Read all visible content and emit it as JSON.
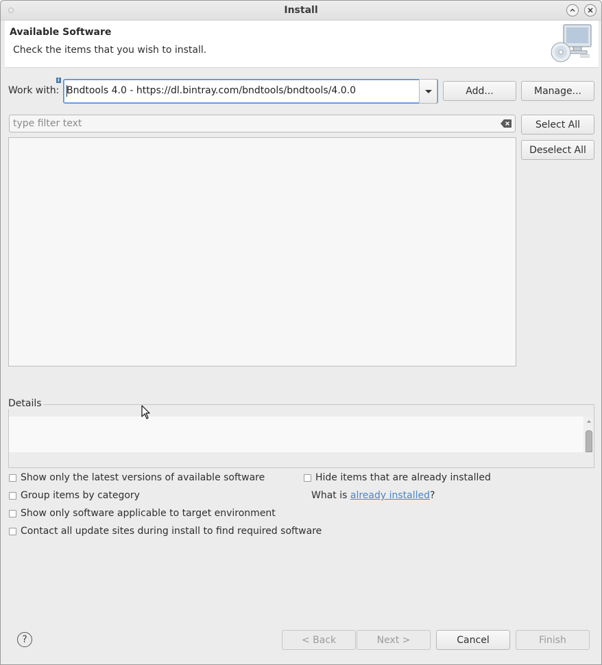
{
  "window": {
    "title": "Install"
  },
  "banner": {
    "heading": "Available Software",
    "subtitle": "Check the items that you wish to install."
  },
  "work_with": {
    "label": "Work with:",
    "value": "Bndtools 4.0 - https://dl.bintray.com/bndtools/bndtools/4.0.0",
    "add_label": "Add...",
    "manage_label": "Manage..."
  },
  "filter": {
    "placeholder": "type filter text",
    "select_all_label": "Select All",
    "deselect_all_label": "Deselect All"
  },
  "details": {
    "label": "Details"
  },
  "options": {
    "latest_versions": "Show only the latest versions of available software",
    "group_by_category": "Group items by category",
    "target_environment": "Show only software applicable to target environment",
    "contact_update_sites": "Contact all update sites during install to find required software",
    "hide_installed": "Hide items that are already installed",
    "what_is_prefix": "What is ",
    "already_installed_link": "already installed",
    "what_is_suffix": "?"
  },
  "footer": {
    "help_symbol": "?",
    "back_label": "< Back",
    "next_label": "Next >",
    "cancel_label": "Cancel",
    "finish_label": "Finish"
  },
  "icons": {
    "window_menu": "window-menu-icon",
    "minimize": "minimize-icon",
    "close": "close-icon",
    "banner": "computer-cd-icon",
    "info": "info-icon",
    "dropdown": "chevron-down-icon",
    "clear": "clear-filter-icon",
    "help": "help-icon"
  }
}
